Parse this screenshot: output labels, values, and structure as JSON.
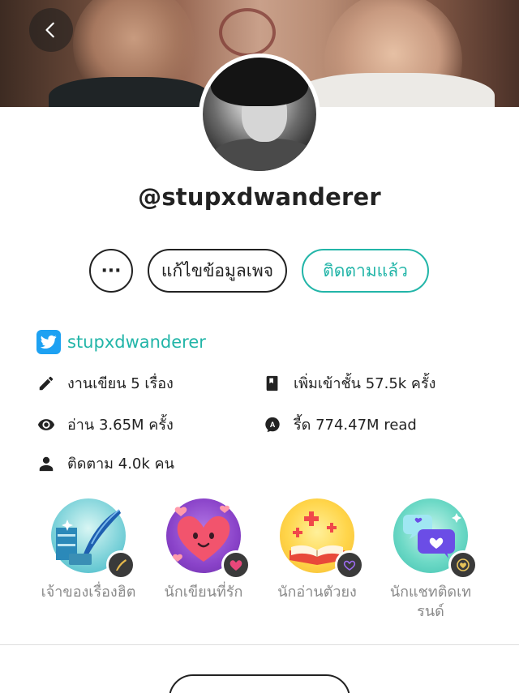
{
  "profile": {
    "username": "@stupxdwanderer"
  },
  "actions": {
    "more_label": "···",
    "edit_label": "แก้ไขข้อมูลเพจ",
    "follow_label": "ติดตามแล้ว"
  },
  "twitter": {
    "handle": "stupxdwanderer"
  },
  "stats": {
    "works": "งานเขียน 5 เรื่อง",
    "library": "เพิ่มเข้าชั้น 57.5k ครั้ง",
    "views": "อ่าน 3.65M ครั้ง",
    "reads": "รี้ด 774.47M read",
    "followers": "ติดตาม 4.0k คน"
  },
  "badges": [
    {
      "label": "เจ้าของเรื่องฮิต",
      "icon": "quill-icon"
    },
    {
      "label": "นักเขียนที่รัก",
      "icon": "heart-icon"
    },
    {
      "label": "นักอ่านตัวยง",
      "icon": "book-icon"
    },
    {
      "label": "นักแชทติดเทรนด์",
      "icon": "chat-icon"
    }
  ],
  "colors": {
    "accent": "#22b5a8",
    "twitter": "#1da1f2"
  }
}
